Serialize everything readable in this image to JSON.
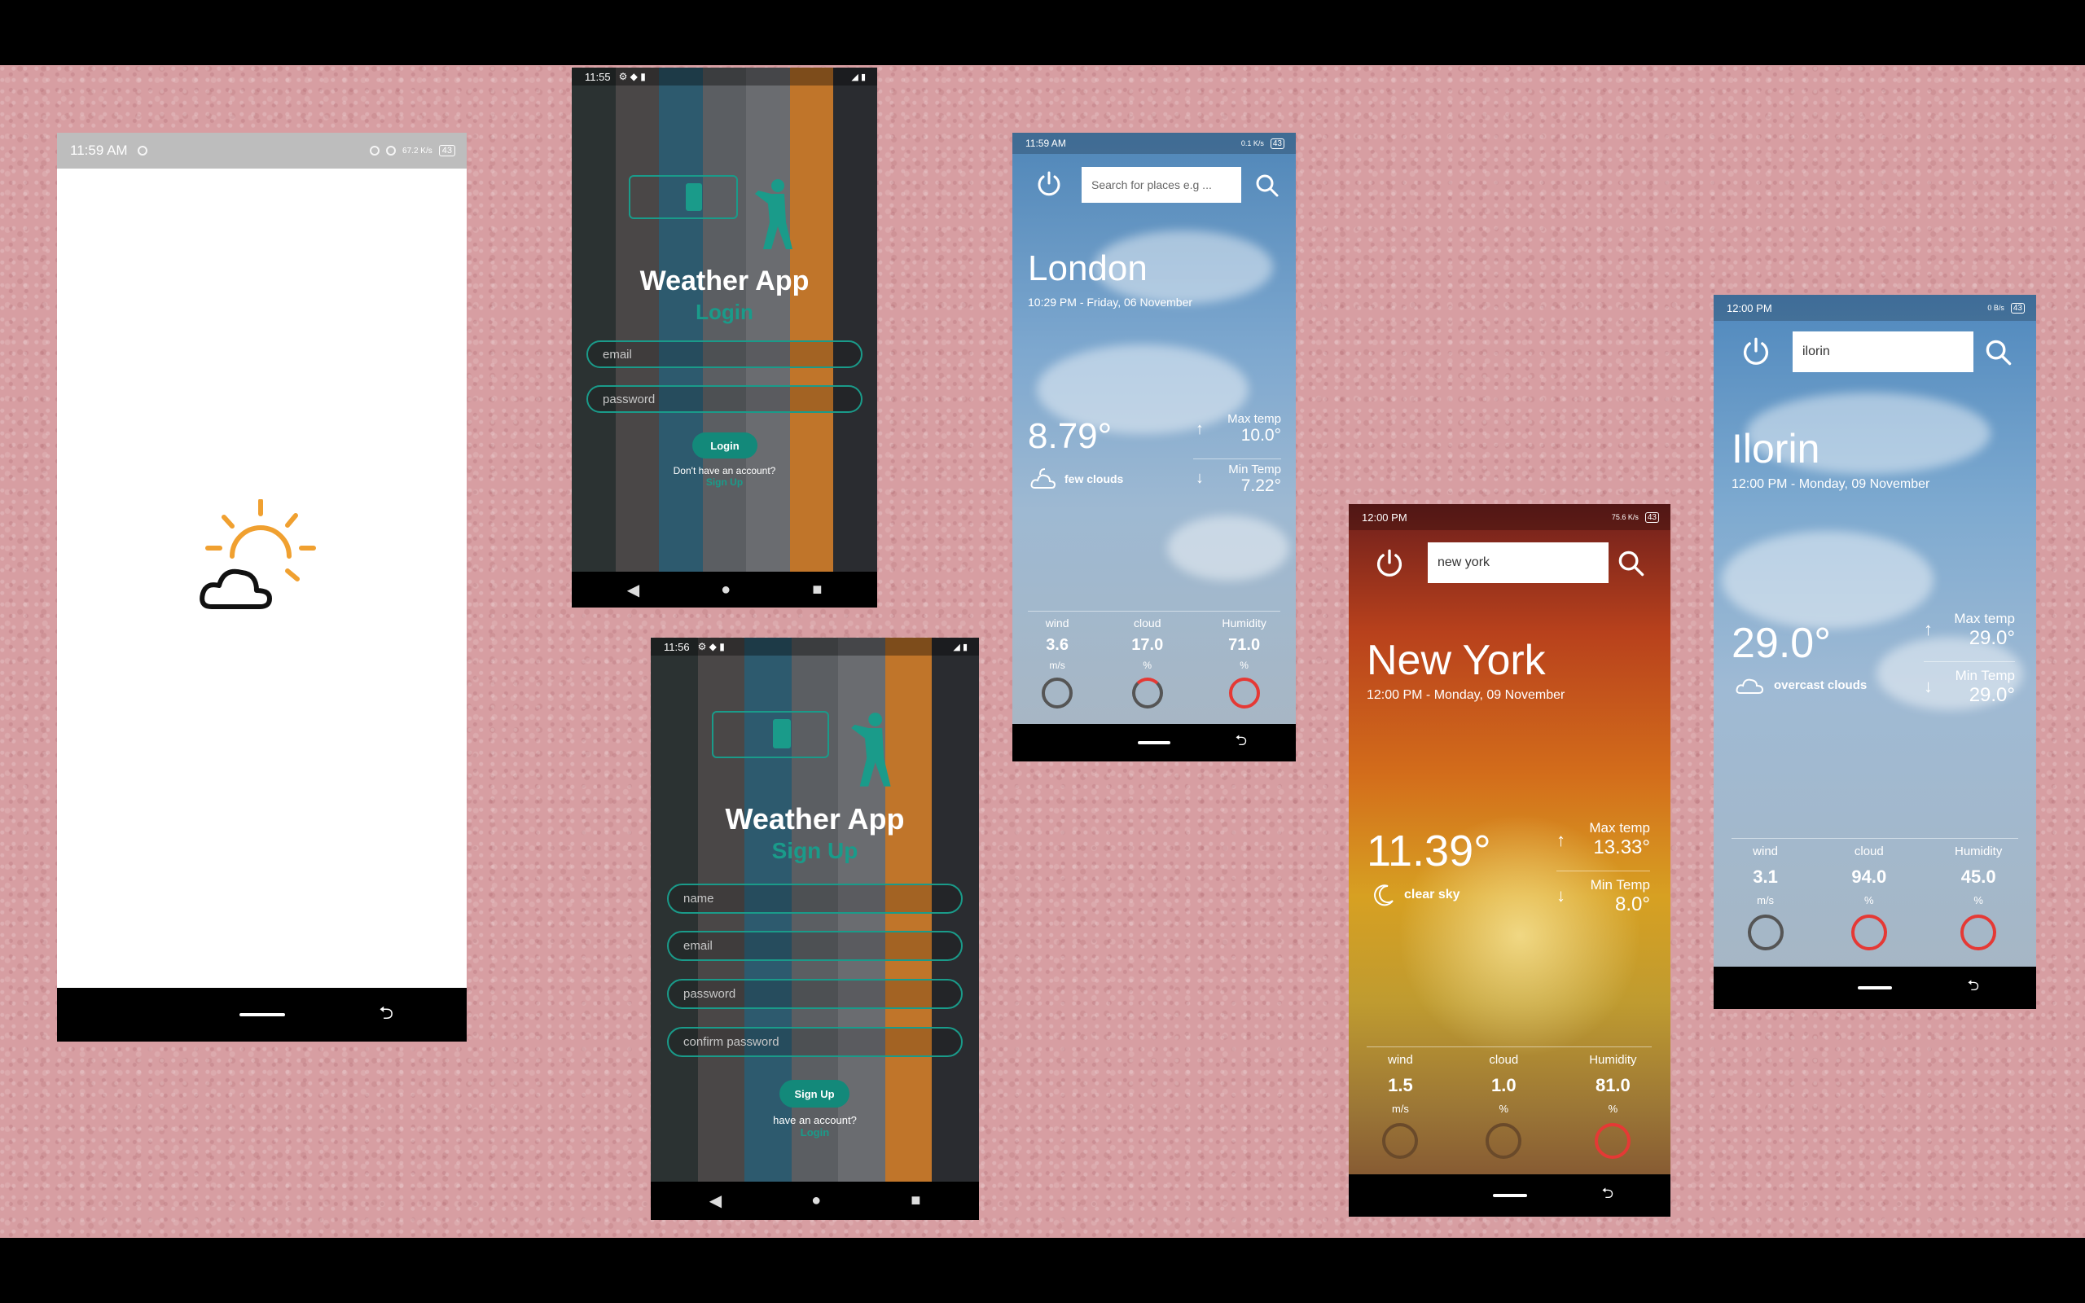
{
  "splash": {
    "status_time": "11:59 AM",
    "status_right": "67.2 K/s",
    "battery": "43"
  },
  "login": {
    "status_time": "11:55",
    "app_title": "Weather App",
    "screen_title": "Login",
    "email_placeholder": "email",
    "password_placeholder": "password",
    "button": "Login",
    "prompt": "Don't have an account?",
    "link": "Sign Up"
  },
  "signup": {
    "status_time": "11:56",
    "app_title": "Weather App",
    "screen_title": "Sign Up",
    "name_placeholder": "name",
    "email_placeholder": "email",
    "password_placeholder": "password",
    "confirm_placeholder": "confirm password",
    "button": "Sign Up",
    "prompt": "have an account?",
    "link": "Login"
  },
  "london": {
    "status_time": "11:59 AM",
    "status_right": "0.1 K/s",
    "battery": "43",
    "search_placeholder": "Search for places e.g ...",
    "city": "London",
    "datetime": "10:29 PM - Friday, 06 November",
    "temp": "8.79°",
    "condition": "few clouds",
    "max_label": "Max temp",
    "max_val": "10.0°",
    "min_label": "Min Temp",
    "min_val": "7.22°",
    "stats": [
      {
        "label": "wind",
        "value": "3.6",
        "unit": "m/s"
      },
      {
        "label": "cloud",
        "value": "17.0",
        "unit": "%"
      },
      {
        "label": "Humidity",
        "value": "71.0",
        "unit": "%"
      }
    ]
  },
  "newyork": {
    "status_time": "12:00 PM",
    "status_right": "75.6 K/s",
    "battery": "43",
    "search_value": "new york",
    "city": "New York",
    "datetime": "12:00 PM - Monday, 09 November",
    "temp": "11.39°",
    "condition": "clear sky",
    "max_label": "Max temp",
    "max_val": "13.33°",
    "min_label": "Min Temp",
    "min_val": "8.0°",
    "stats": [
      {
        "label": "wind",
        "value": "1.5",
        "unit": "m/s"
      },
      {
        "label": "cloud",
        "value": "1.0",
        "unit": "%"
      },
      {
        "label": "Humidity",
        "value": "81.0",
        "unit": "%"
      }
    ]
  },
  "ilorin": {
    "status_time": "12:00 PM",
    "status_right": "0 B/s",
    "battery": "43",
    "search_value": "ilorin",
    "city": "Ilorin",
    "datetime": "12:00 PM - Monday, 09 November",
    "temp": "29.0°",
    "condition": "overcast clouds",
    "max_label": "Max temp",
    "max_val": "29.0°",
    "min_label": "Min Temp",
    "min_val": "29.0°",
    "stats": [
      {
        "label": "wind",
        "value": "3.1",
        "unit": "m/s"
      },
      {
        "label": "cloud",
        "value": "94.0",
        "unit": "%"
      },
      {
        "label": "Humidity",
        "value": "45.0",
        "unit": "%"
      }
    ]
  },
  "colors": {
    "teal": "#1a9b8a",
    "sun": "#f0a030",
    "ring_red": "#e53935",
    "ring_grey": "#555555"
  }
}
